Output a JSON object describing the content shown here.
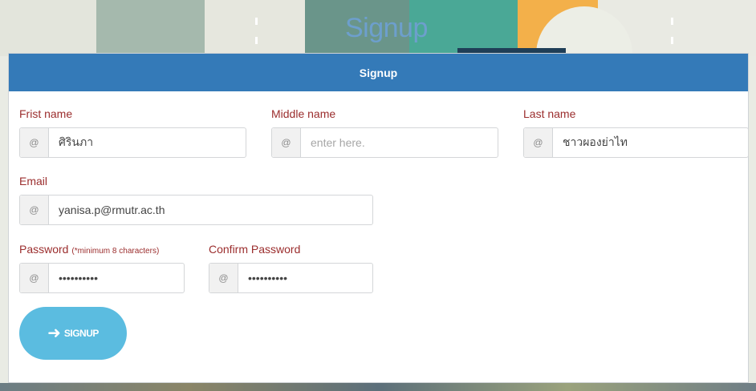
{
  "background": {
    "title": "Signup"
  },
  "panel": {
    "heading": "Signup"
  },
  "form": {
    "first_name": {
      "label": "Frist name",
      "value": "ศิรินภา",
      "icon": "at-icon"
    },
    "middle_name": {
      "label": "Middle name",
      "placeholder": "enter here.",
      "icon": "at-icon"
    },
    "last_name": {
      "label": "Last name",
      "value": "ชาวผองย่าไท",
      "icon": "at-icon"
    },
    "email": {
      "label": "Email",
      "value": "yanisa.p@rmutr.ac.th",
      "icon": "at-icon"
    },
    "password": {
      "label": "Password",
      "note": "(*minimum 8 characters)",
      "value": "••••••••••",
      "icon": "at-icon"
    },
    "confirm_password": {
      "label": "Confirm Password",
      "value": "••••••••••",
      "icon": "at-icon"
    }
  },
  "submit": {
    "label": "SIGNUP",
    "icon": "sign-in-icon"
  },
  "colors": {
    "header": "#347ab8",
    "label": "#9b2d2d",
    "button": "#5bbce0"
  }
}
